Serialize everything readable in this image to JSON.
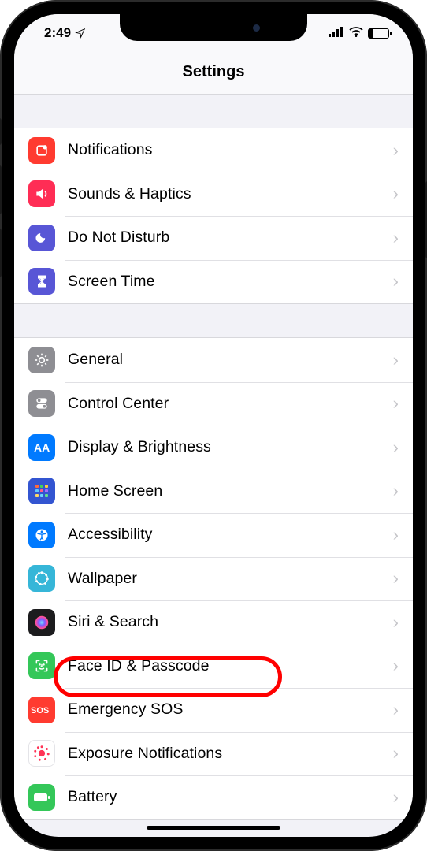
{
  "status": {
    "time": "2:49",
    "location_icon": "location-arrow",
    "signal_icon": "cellular-signal",
    "wifi_icon": "wifi",
    "battery_icon": "battery-low"
  },
  "header": {
    "title": "Settings"
  },
  "groups": [
    {
      "items": [
        {
          "icon": "notifications-icon",
          "icon_bg": "#ff3b30",
          "label": "Notifications"
        },
        {
          "icon": "sounds-icon",
          "icon_bg": "#ff2d55",
          "label": "Sounds & Haptics"
        },
        {
          "icon": "do-not-disturb-icon",
          "icon_bg": "#5856d6",
          "label": "Do Not Disturb"
        },
        {
          "icon": "screen-time-icon",
          "icon_bg": "#5856d6",
          "label": "Screen Time"
        }
      ]
    },
    {
      "items": [
        {
          "icon": "general-icon",
          "icon_bg": "#8e8e93",
          "label": "General"
        },
        {
          "icon": "control-center-icon",
          "icon_bg": "#8e8e93",
          "label": "Control Center"
        },
        {
          "icon": "display-icon",
          "icon_bg": "#007aff",
          "label": "Display & Brightness"
        },
        {
          "icon": "home-screen-icon",
          "icon_bg": "#3355d1",
          "label": "Home Screen"
        },
        {
          "icon": "accessibility-icon",
          "icon_bg": "#007aff",
          "label": "Accessibility"
        },
        {
          "icon": "wallpaper-icon",
          "icon_bg": "#36b6d8",
          "label": "Wallpaper"
        },
        {
          "icon": "siri-icon",
          "icon_bg": "#1c1c1e",
          "label": "Siri & Search"
        },
        {
          "icon": "faceid-icon",
          "icon_bg": "#34c759",
          "label": "Face ID & Passcode",
          "highlighted": true
        },
        {
          "icon": "sos-icon",
          "icon_bg": "#ff3b30",
          "label": "Emergency SOS"
        },
        {
          "icon": "exposure-icon",
          "icon_bg": "#ffffff",
          "label": "Exposure Notifications"
        },
        {
          "icon": "battery-icon",
          "icon_bg": "#34c759",
          "label": "Battery"
        }
      ]
    }
  ],
  "annotation": {
    "highlight_target_label": "Face ID & Passcode",
    "highlight_color": "#ff0000"
  }
}
